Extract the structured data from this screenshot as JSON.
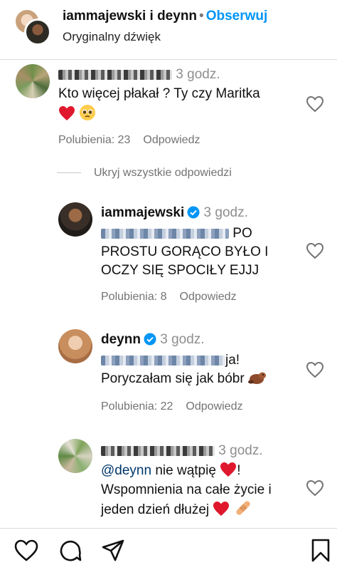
{
  "header": {
    "title_users": "iammajewski i deynn",
    "dot": "•",
    "follow_label": "Obserwuj",
    "subtitle": "Oryginalny dźwięk"
  },
  "comments": [
    {
      "time": "3 godz.",
      "text_line1": "Kto więcej płakał ? Ty czy Maritka",
      "likes": "Polubienia: 23",
      "reply": "Odpowiedz"
    },
    {
      "username": "iammajewski",
      "time": "3 godz.",
      "text_line1_tail": "PO",
      "text_line2": "PROSTU GORĄCO BYŁO I",
      "text_line3": "OCZY SIĘ SPOCIŁY EJJJ",
      "likes": "Polubienia: 8",
      "reply": "Odpowiedz"
    },
    {
      "username": "deynn",
      "time": "3 godz.",
      "text_line1_tail": "ja!",
      "text_line2": "Poryczałam się jak bóbr",
      "likes": "Polubienia: 22",
      "reply": "Odpowiedz"
    },
    {
      "time": "3 godz.",
      "mention": "@deynn",
      "text_line1_tail": "nie wątpię",
      "text_line1_end": "!",
      "text_line2": "Wspomnienia na całe życie i",
      "text_line3": "jeden dzień dłużej"
    }
  ],
  "hide_replies_label": "Ukryj wszystkie odpowiedzi",
  "icons": [
    "heart-icon",
    "comment-icon",
    "share-icon",
    "bookmark-icon",
    "verified-badge-icon",
    "red-heart-emoji",
    "pleading-face-emoji",
    "beaver-emoji",
    "bandage-emoji"
  ],
  "colors": {
    "follow": "#0095f6",
    "mention": "#00376b",
    "meta": "#737373",
    "verified": "#0095f6",
    "heart_emoji": "#e0182d"
  }
}
